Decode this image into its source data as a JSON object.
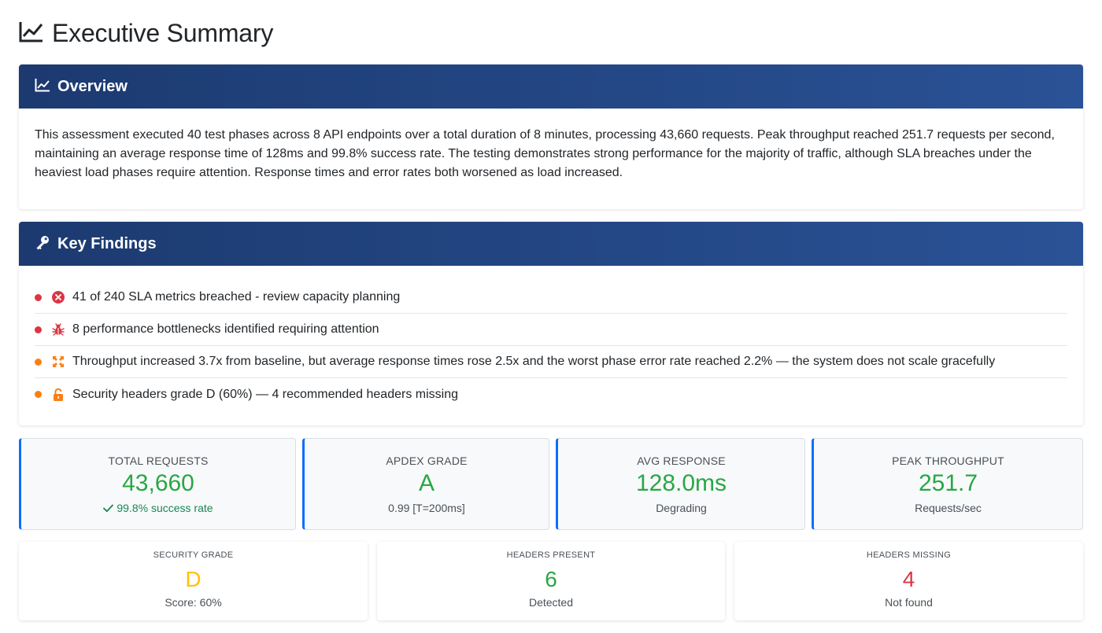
{
  "page": {
    "title": "Executive Summary"
  },
  "overview": {
    "header": "Overview",
    "text": "This assessment executed 40 test phases across 8 API endpoints over a total duration of 8 minutes, processing 43,660 requests. Peak throughput reached 251.7 requests per second, maintaining an average response time of 128ms and 99.8% success rate. The testing demonstrates strong performance for the majority of traffic, although SLA breaches under the heaviest load phases require attention. Response times and error rates both worsened as load increased."
  },
  "findings": {
    "header": "Key Findings",
    "items": [
      {
        "text": "41 of 240 SLA metrics breached - review capacity planning",
        "icon": "x-circle-icon",
        "severity_color": "#dc3545"
      },
      {
        "text": "8 performance bottlenecks identified requiring attention",
        "icon": "bug-icon",
        "severity_color": "#dc3545"
      },
      {
        "text": "Throughput increased 3.7x from baseline, but average response times rose 2.5x and the worst phase error rate reached 2.2% — the system does not scale gracefully",
        "icon": "expand-icon",
        "severity_color": "#fd7e14"
      },
      {
        "text": "Security headers grade D (60%) — 4 recommended headers missing",
        "icon": "unlock-icon",
        "severity_color": "#fd7e14"
      }
    ]
  },
  "metrics": [
    {
      "label": "TOTAL REQUESTS",
      "value": "43,660",
      "sub": "99.8% success rate",
      "sub_icon": "check-icon"
    },
    {
      "label": "APDEX GRADE",
      "value": "A",
      "sub": "0.99 [T=200ms]"
    },
    {
      "label": "AVG RESPONSE",
      "value": "128.0ms",
      "sub": "Degrading"
    },
    {
      "label": "PEAK THROUGHPUT",
      "value": "251.7",
      "sub": "Requests/sec"
    }
  ],
  "security": [
    {
      "label": "SECURITY GRADE",
      "value": "D",
      "sub": "Score: 60%",
      "color": "#ffc107"
    },
    {
      "label": "HEADERS PRESENT",
      "value": "6",
      "sub": "Detected",
      "color": "#28a745"
    },
    {
      "label": "HEADERS MISSING",
      "value": "4",
      "sub": "Not found",
      "color": "#dc3545"
    }
  ],
  "colors": {
    "header_start": "#1c3a70",
    "header_end": "#2a5296",
    "success": "#28a745",
    "danger": "#dc3545",
    "warning": "#fd7e14",
    "accent": "#0d6efd"
  }
}
